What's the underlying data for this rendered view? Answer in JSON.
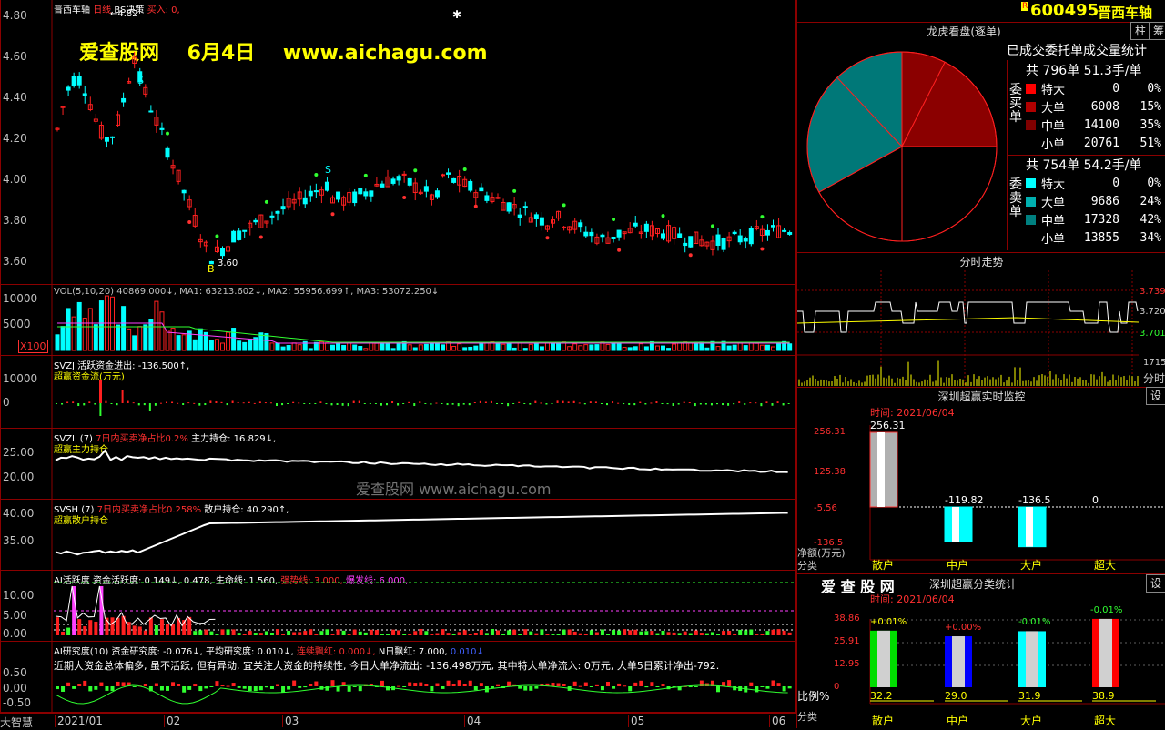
{
  "stock": {
    "code": "600495",
    "name": "晋西车轴",
    "badge": "R"
  },
  "topbar": {
    "btn_a": "柱",
    "btn_b": "筹"
  },
  "main_chart": {
    "header": {
      "name": "晋西车轴",
      "period": "日线",
      "bs": "BS决策",
      "buy": "买入: 0,"
    },
    "price_labels": [
      "4.80",
      "4.60",
      "4.40",
      "4.20",
      "4.00",
      "3.80",
      "3.60"
    ],
    "high_mark": "4.82",
    "low_mark": "3.60",
    "signal_s": "S",
    "signal_b": "B",
    "watermark": "爱查股网    6月4日    www.aichagu.com"
  },
  "vol": {
    "header": "VOL(5,10,20) 40869.000↓, MA1: 63213.602↓, MA2: 55956.699↑, MA3: 53072.250↓",
    "labels": [
      "10000",
      "5000"
    ],
    "unit": "X100"
  },
  "svzj": {
    "header": "SVZJ  活跃资金进出: -136.500↑,",
    "sub": "超赢资金流(万元)",
    "labels": [
      "10000",
      "0"
    ]
  },
  "svzl": {
    "header_a": "SVZL (7)",
    "header_b": "7日内买卖净占比0.2%",
    "header_c": "主力持仓: 16.829↓,",
    "sub": "超赢主力持仓",
    "labels": [
      "25.00",
      "20.00"
    ]
  },
  "svsh": {
    "header_a": "SVSH (7)",
    "header_b": "7日内买卖净占比0.258%",
    "header_c": "散户持仓: 40.290↑,",
    "sub": "超赢散户持仓",
    "labels": [
      "40.00",
      "35.00"
    ]
  },
  "ai": {
    "header_a": "AI活跃度  资金活跃度: 0.149↓, 0.478, 生命线: 1.560,",
    "header_b": "强势线: 3.000,",
    "header_c": "爆发线: 6.000,",
    "labels": [
      "10.00",
      "5.00",
      "0.00"
    ]
  },
  "research": {
    "header_a": "AI研究度(10) 资金研究度: -0.076↓, 平均研究度: 0.010↓,",
    "header_b": "连续飘红: 0.000↓,",
    "header_c": "N日飘红: 7.000,",
    "header_d": "0.010↓",
    "comment": "近期大资金总体偏多, 虽不活跃, 但有异动, 宜关注大资金的持续性, 今日大单净流出: -136.498万元, 其中特大单净流入: 0万元, 大单5日累计净出-792.",
    "labels": [
      "0.50",
      "0.00",
      "-0.50"
    ]
  },
  "xaxis": {
    "corner": "大智慧",
    "labels": [
      "2021/01",
      "02",
      "03",
      "04",
      "05",
      "06"
    ]
  },
  "dragon": {
    "title": "龙虎看盘(逐单)",
    "subtitle": "已成交委托单成交量统计",
    "buy_side_label": "委买单",
    "sell_side_label": "委卖单",
    "buy_total": "共 796单 51.3手/单",
    "sell_total": "共 754单 54.2手/单",
    "buy_rows": [
      {
        "label": "特大",
        "value": "0",
        "pct": "0%",
        "color": "#ff0000"
      },
      {
        "label": "大单",
        "value": "6008",
        "pct": "15%",
        "color": "#b00000"
      },
      {
        "label": "中单",
        "value": "14100",
        "pct": "35%",
        "color": "#800000"
      },
      {
        "label": "小单",
        "value": "20761",
        "pct": "51%",
        "color": "#000000"
      }
    ],
    "sell_rows": [
      {
        "label": "特大",
        "value": "0",
        "pct": "0%",
        "color": "#00ffff"
      },
      {
        "label": "大单",
        "value": "9686",
        "pct": "24%",
        "color": "#00b0b0"
      },
      {
        "label": "中单",
        "value": "17328",
        "pct": "42%",
        "color": "#008080"
      },
      {
        "label": "小单",
        "value": "13855",
        "pct": "34%",
        "color": "#000000"
      }
    ],
    "pie_pcts": {
      "buy_big": 15,
      "buy_mid": 35,
      "sell_mid": 42,
      "sell_big": 24
    }
  },
  "intraday": {
    "title": "分时走势",
    "price_labels": [
      "3.739",
      "3.720",
      "3.701"
    ],
    "vol_label": "1715",
    "vol_unit": "分时"
  },
  "monitor": {
    "title": "深圳超赢实时监控",
    "set": "设",
    "time": "时间: 2021/06/04",
    "y_labels": [
      "256.31",
      "125.38",
      "-5.56",
      "-136.5"
    ],
    "axis_title": "净额(万元)",
    "cat_title": "分类",
    "categories": [
      "散户",
      "中户",
      "大户",
      "超大"
    ],
    "values": [
      256.31,
      -119.82,
      -136.5,
      0
    ],
    "value_labels": [
      "256.31",
      "-119.82",
      "-136.5",
      "0"
    ]
  },
  "classify": {
    "brand": "爱 查 股 网",
    "title": "深圳超赢分类统计",
    "set": "设",
    "time": "时间: 2021/06/04",
    "y_labels": [
      "38.86",
      "25.91",
      "12.95",
      "0"
    ],
    "axis_title": "比例%",
    "cat_title": "分类",
    "categories": [
      "散户",
      "中户",
      "大户",
      "超大"
    ],
    "values": [
      32.2,
      29.0,
      31.9,
      38.9
    ],
    "value_labels": [
      "32.2",
      "29.0",
      "31.9",
      "38.9"
    ],
    "change_labels": [
      "+0.01%",
      "+0.00%",
      "-0.01%",
      "-0.01%"
    ],
    "colors": [
      "#00dd00",
      "#0000ff",
      "#00ffff",
      "#ff0000"
    ]
  }
}
